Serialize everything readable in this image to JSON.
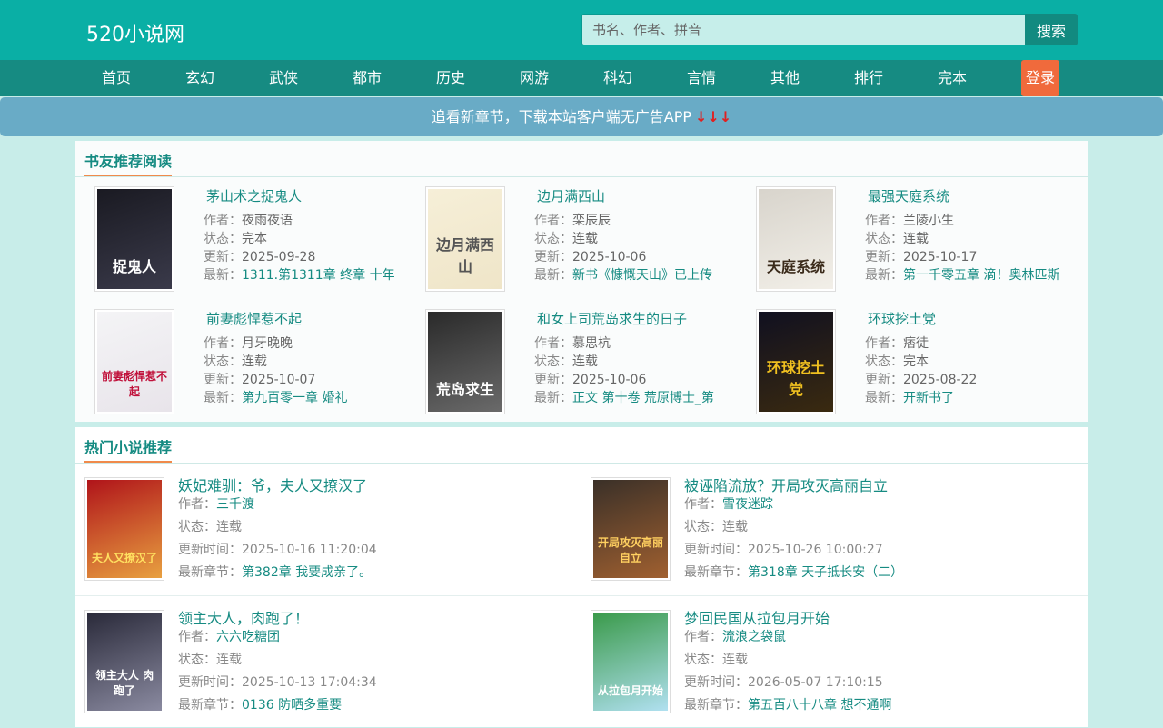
{
  "header": {
    "logo": "520小说网",
    "search_placeholder": "书名、作者、拼音",
    "search_button": "搜索"
  },
  "nav": {
    "items": [
      "首页",
      "玄幻",
      "武侠",
      "都市",
      "历史",
      "网游",
      "科幻",
      "言情",
      "其他",
      "排行",
      "完本"
    ],
    "login": "登录"
  },
  "banner": {
    "text": "追看新章节，下载本站客户端无广告APP",
    "arrows": "↓↓↓"
  },
  "recommend": {
    "title": "书友推荐阅读",
    "labels": {
      "author": "作者：",
      "status": "状态：",
      "updated": "更新：",
      "latest": "最新："
    },
    "books": [
      {
        "name": "茅山术之捉鬼人",
        "author": "夜雨夜语",
        "status": "完本",
        "updated": "2025-09-28",
        "latest": "1311.第1311章 终章 十年",
        "cover_colors": [
          "#1a1a22",
          "#3a3a4a"
        ],
        "cover_text": "捉鬼人",
        "cover_text_color": "#ffffff"
      },
      {
        "name": "边月满西山",
        "author": "栾辰辰",
        "status": "连载",
        "updated": "2025-10-06",
        "latest": "新书《慷慨天山》已上传",
        "cover_colors": [
          "#f6efd8",
          "#efe5c8"
        ],
        "cover_text": "边月满西山",
        "cover_text_color": "#555555"
      },
      {
        "name": "最强天庭系统",
        "author": "兰陵小生",
        "status": "连载",
        "updated": "2025-10-17",
        "latest": "第一千零五章 滴！奥林匹斯",
        "cover_colors": [
          "#d8d4cc",
          "#f2efe8"
        ],
        "cover_text": "天庭系统",
        "cover_text_color": "#3a2a1a"
      },
      {
        "name": "前妻彪悍惹不起",
        "author": "月牙晚晚",
        "status": "连载",
        "updated": "2025-10-07",
        "latest": "第九百零一章 婚礼",
        "cover_colors": [
          "#f4f4f6",
          "#e8e4ea"
        ],
        "cover_text": "前妻彪悍惹不起",
        "cover_text_color": "#c0103a"
      },
      {
        "name": "和女上司荒岛求生的日子",
        "author": "慕思杭",
        "status": "连载",
        "updated": "2025-10-06",
        "latest": "正文 第十卷 荒原博士_第",
        "cover_colors": [
          "#2a2a2a",
          "#6a6a6a"
        ],
        "cover_text": "荒岛求生",
        "cover_text_color": "#ffffff"
      },
      {
        "name": "环球挖土党",
        "author": "痞徒",
        "status": "完本",
        "updated": "2025-08-22",
        "latest": "开新书了",
        "cover_colors": [
          "#101020",
          "#3a2a10"
        ],
        "cover_text": "环球挖土党",
        "cover_text_color": "#f0c020"
      }
    ]
  },
  "hot": {
    "title": "热门小说推荐",
    "labels": {
      "author": "作者：",
      "status": "状态：",
      "updated": "更新时间：",
      "latest": "最新章节："
    },
    "books": [
      {
        "name": "妖妃难驯：爷，夫人又撩汉了",
        "author": "三千渡",
        "status": "连载",
        "updated": "2025-10-16 11:20:04",
        "latest": "第382章 我要成亲了。",
        "cover_colors": [
          "#b0141a",
          "#e8a040"
        ],
        "cover_text": "夫人又撩汉了",
        "cover_text_color": "#ffe060"
      },
      {
        "name": "被诬陷流放？开局攻灭高丽自立",
        "author": "雪夜迷踪",
        "status": "连载",
        "updated": "2025-10-26 10:00:27",
        "latest": "第318章 天子抵长安（二）",
        "cover_colors": [
          "#3a3028",
          "#a06030"
        ],
        "cover_text": "开局攻灭高丽自立",
        "cover_text_color": "#ffd060"
      },
      {
        "name": "领主大人，肉跑了！",
        "author": "六六吃糖团",
        "status": "连载",
        "updated": "2025-10-13 17:04:34",
        "latest": "0136 防晒多重要",
        "cover_colors": [
          "#2a2a3a",
          "#8a8aa0"
        ],
        "cover_text": "领主大人 肉跑了",
        "cover_text_color": "#ffffff"
      },
      {
        "name": "梦回民国从拉包月开始",
        "author": "流浪之袋鼠",
        "status": "连载",
        "updated": "2026-05-07 17:10:15",
        "latest": "第五百八十八章 想不通啊",
        "cover_colors": [
          "#3a9a4a",
          "#b0e0f0"
        ],
        "cover_text": "从拉包月开始",
        "cover_text_color": "#ffffff"
      }
    ]
  }
}
